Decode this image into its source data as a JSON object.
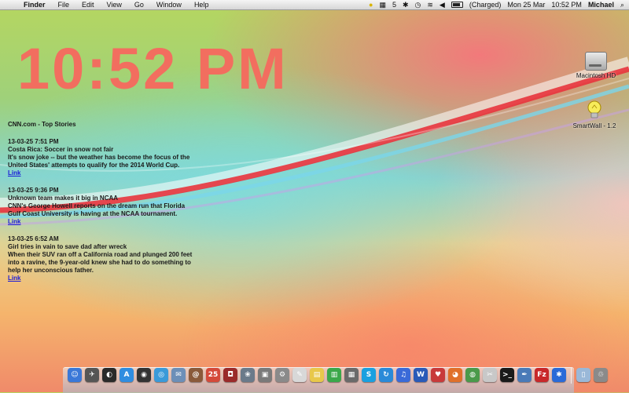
{
  "menubar": {
    "items": [
      "Finder",
      "File",
      "Edit",
      "View",
      "Go",
      "Window",
      "Help"
    ],
    "status": {
      "spaces": "5",
      "battery_state": "(Charged)",
      "date": "Mon 25 Mar",
      "time": "10:52 PM",
      "user": "Michael"
    }
  },
  "clock": {
    "text": "10:52 PM",
    "color": "#f26e5f"
  },
  "news": {
    "header": "CNN.com - Top Stories",
    "stories": [
      {
        "timestamp": "13-03-25 7:51 PM",
        "headline": "Costa Rica: Soccer in snow not fair",
        "summary": "It's snow joke -- but the weather has become the focus of the United States' attempts to qualify for the 2014 World Cup.",
        "link": "Link"
      },
      {
        "timestamp": "13-03-25 9:36 PM",
        "headline": "Unknown team makes it big in NCAA",
        "summary": "CNN's George Howell reports on the dream run that Florida Gulf Coast University is having at the NCAA tournament.",
        "link": "Link"
      },
      {
        "timestamp": "13-03-25 6:52 AM",
        "headline": "Girl tries in vain to save dad after wreck",
        "summary": "When their SUV ran off a California road and plunged 200 feet into a ravine, the 9-year-old knew she had to do something to help her unconscious father.",
        "link": "Link"
      }
    ]
  },
  "desktop_icons": [
    {
      "label": "Macintosh HD",
      "icon": "hard-drive-icon"
    },
    {
      "label": "SmartWall - 1.2",
      "icon": "lightbulb-icon"
    }
  ],
  "dock": {
    "items": [
      {
        "name": "finder-icon",
        "glyph": "☺",
        "color": "#3a78d8"
      },
      {
        "name": "launchpad-icon",
        "glyph": "✈",
        "color": "#555555"
      },
      {
        "name": "dashboard-icon",
        "glyph": "◐",
        "color": "#2a2a2a"
      },
      {
        "name": "app-store-icon",
        "glyph": "A",
        "color": "#2f8de0"
      },
      {
        "name": "activity-icon",
        "glyph": "◉",
        "color": "#333333"
      },
      {
        "name": "safari-icon",
        "glyph": "◎",
        "color": "#3a9ad9"
      },
      {
        "name": "mail-icon",
        "glyph": "✉",
        "color": "#6c8fb8"
      },
      {
        "name": "address-book-icon",
        "glyph": "@",
        "color": "#8a5a3a"
      },
      {
        "name": "calendar-icon",
        "glyph": "25",
        "color": "#d44a3a"
      },
      {
        "name": "photo-booth-icon",
        "glyph": "◘",
        "color": "#9a2a2a"
      },
      {
        "name": "iphoto-icon",
        "glyph": "❀",
        "color": "#6a7a8a"
      },
      {
        "name": "preview-icon",
        "glyph": "▣",
        "color": "#7a7a7a"
      },
      {
        "name": "system-prefs-icon",
        "glyph": "⚙",
        "color": "#8a8a8a"
      },
      {
        "name": "textedit-icon",
        "glyph": "✎",
        "color": "#d8d8d8"
      },
      {
        "name": "stickies-icon",
        "glyph": "▤",
        "color": "#e8c84a"
      },
      {
        "name": "numbers-icon",
        "glyph": "▥",
        "color": "#3aa84a"
      },
      {
        "name": "keynote-icon",
        "glyph": "▦",
        "color": "#6a6a6a"
      },
      {
        "name": "skype-icon",
        "glyph": "S",
        "color": "#1aa0e0"
      },
      {
        "name": "sync-icon",
        "glyph": "↻",
        "color": "#2a8ad8"
      },
      {
        "name": "itunes-icon",
        "glyph": "♫",
        "color": "#3a6ad8"
      },
      {
        "name": "word-icon",
        "glyph": "W",
        "color": "#2a5ab8"
      },
      {
        "name": "tweet-icon",
        "glyph": "♥",
        "color": "#c83a3a"
      },
      {
        "name": "firefox-icon",
        "glyph": "◕",
        "color": "#e0702a"
      },
      {
        "name": "chrome-icon",
        "glyph": "◍",
        "color": "#4a9a4a"
      },
      {
        "name": "clipboard-icon",
        "glyph": "✂",
        "color": "#c8c8c8"
      },
      {
        "name": "terminal-icon",
        "glyph": ">_",
        "color": "#1a1a1a"
      },
      {
        "name": "xcode-icon",
        "glyph": "✒",
        "color": "#4a7ab8"
      },
      {
        "name": "filezilla-icon",
        "glyph": "Fz",
        "color": "#c8282a"
      },
      {
        "name": "bluetooth-icon",
        "glyph": "✱",
        "color": "#2a6ad8"
      },
      {
        "name": "documents-icon",
        "glyph": "▯",
        "color": "#9ab8d8"
      },
      {
        "name": "trash-icon",
        "glyph": "♲",
        "color": "#8a8a8a"
      }
    ]
  }
}
